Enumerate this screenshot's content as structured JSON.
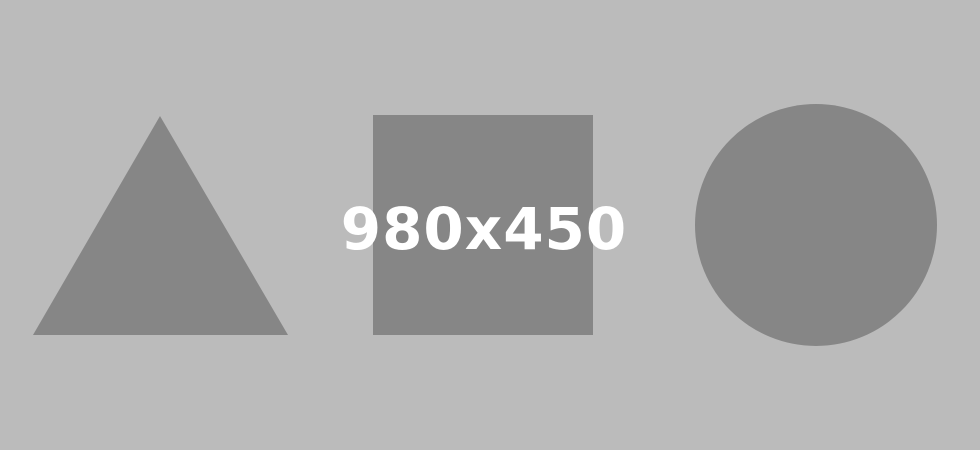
{
  "placeholder": {
    "label": "980x450",
    "shapes": [
      "triangle",
      "square",
      "circle"
    ]
  },
  "colors": {
    "background": "#BBBBBB",
    "shape_fill": "#868686",
    "text": "#FFFFFF"
  }
}
